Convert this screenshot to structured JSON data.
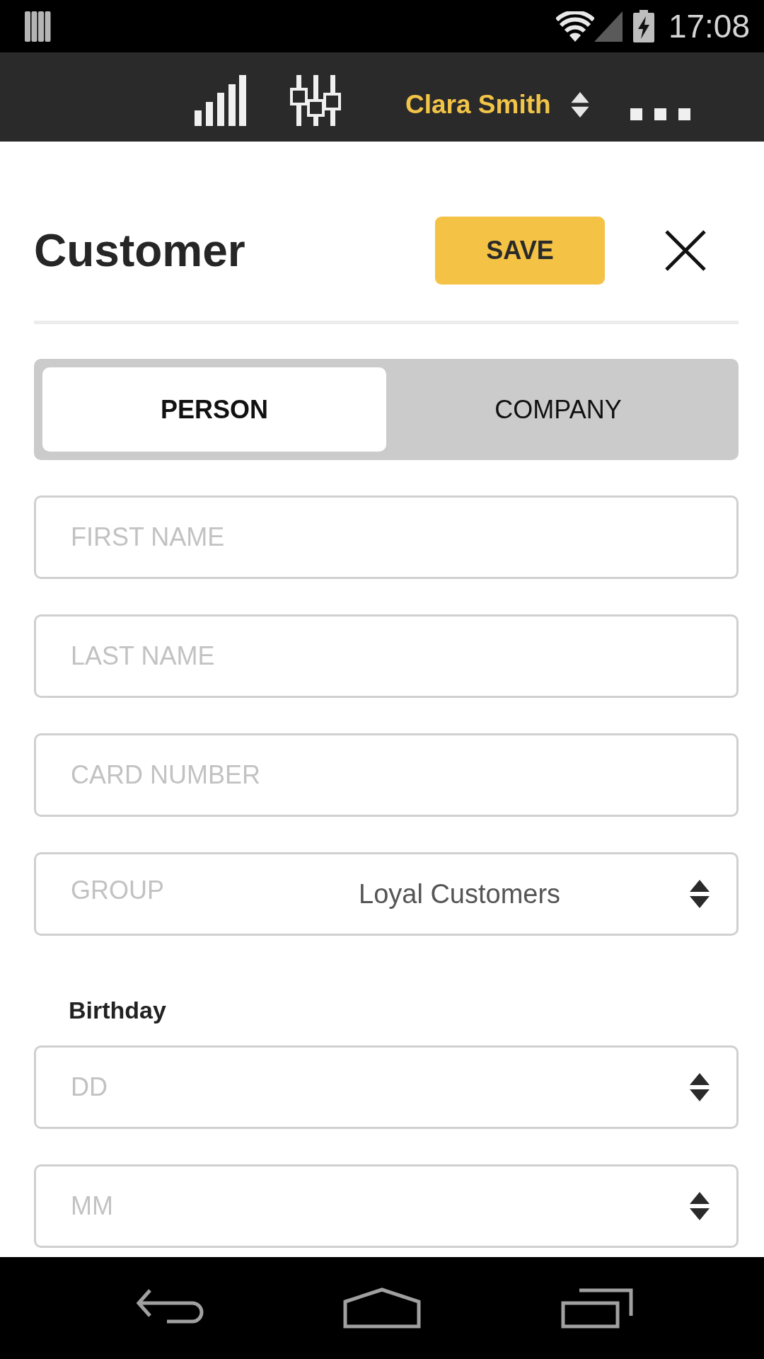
{
  "status_bar": {
    "time": "17:08"
  },
  "app_bar": {
    "user_name": "Clara Smith"
  },
  "header": {
    "title": "Customer",
    "save_label": "SAVE"
  },
  "customer_type_tabs": [
    {
      "label": "PERSON",
      "selected": true
    },
    {
      "label": "COMPANY",
      "selected": false
    }
  ],
  "fields": [
    {
      "kind": "text",
      "placeholder": "FIRST NAME"
    },
    {
      "kind": "text",
      "placeholder": "LAST NAME"
    },
    {
      "kind": "text",
      "placeholder": "CARD NUMBER"
    },
    {
      "kind": "select",
      "label": "GROUP",
      "value": "Loyal Customers"
    }
  ],
  "birthday": {
    "label": "Birthday",
    "fields": [
      {
        "kind": "select",
        "placeholder": "DD"
      },
      {
        "kind": "select",
        "placeholder": "MM"
      }
    ]
  }
}
